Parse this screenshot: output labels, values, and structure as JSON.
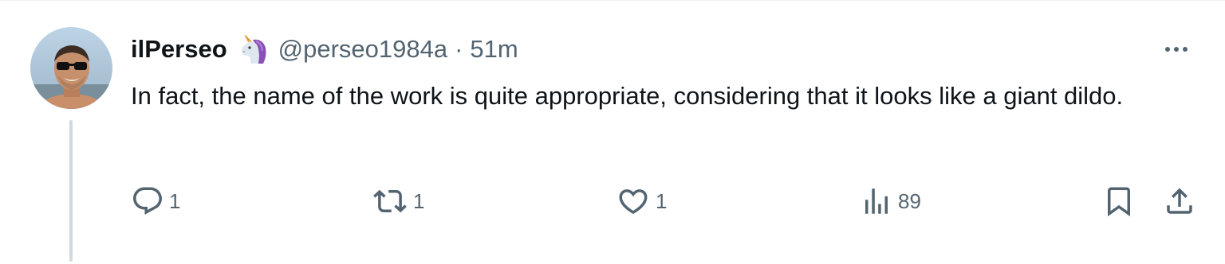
{
  "tweet": {
    "display_name": "ilPerseo",
    "badge_icon": "unicorn-icon",
    "handle": "@perseo1984a",
    "separator": "·",
    "time": "51m",
    "text": "In fact, the name of the work is quite appropriate, considering that it looks like a giant dildo."
  },
  "actions": {
    "reply": {
      "icon": "reply-icon",
      "count": "1"
    },
    "retweet": {
      "icon": "retweet-icon",
      "count": "1"
    },
    "like": {
      "icon": "heart-icon",
      "count": "1"
    },
    "views": {
      "icon": "views-chart-icon",
      "count": "89"
    },
    "bookmark": {
      "icon": "bookmark-icon"
    },
    "share": {
      "icon": "share-icon"
    }
  },
  "colors": {
    "text": "#0f1419",
    "muted": "#536471",
    "thread_line": "#cfd9de"
  }
}
